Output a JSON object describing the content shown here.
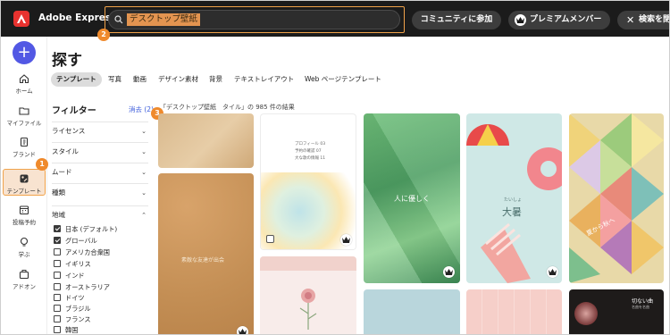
{
  "header": {
    "brand": "Adobe Express",
    "search_value": "デスクトップ壁紙",
    "community_label": "コミュニティに参加",
    "premium_label": "プレミアムメンバー",
    "close_search_label": "検索を閉"
  },
  "badges": {
    "one": "1",
    "two": "2",
    "three": "3"
  },
  "sidebar": {
    "items": [
      {
        "label": "ホーム",
        "icon": "home-icon"
      },
      {
        "label": "マイファイル",
        "icon": "folder-icon"
      },
      {
        "label": "ブランド",
        "icon": "brand-icon"
      },
      {
        "label": "テンプレート",
        "icon": "template-icon",
        "active": true
      },
      {
        "label": "投稿予約",
        "icon": "calendar-icon"
      },
      {
        "label": "学ぶ",
        "icon": "bulb-icon"
      },
      {
        "label": "アドオン",
        "icon": "addon-icon"
      }
    ]
  },
  "main": {
    "title": "探す",
    "tabs": [
      "テンプレート",
      "写真",
      "動画",
      "デザイン素材",
      "背景",
      "テキストレイアウト",
      "Web ページテンプレート"
    ]
  },
  "filters": {
    "title": "フィルター",
    "clear_label": "消去 (2)",
    "results_text": "「デスクトップ壁紙　タイル」の 985 件の結果",
    "sections": [
      {
        "label": "ライセンス",
        "chevron": "⌄"
      },
      {
        "label": "スタイル",
        "chevron": "⌄"
      },
      {
        "label": "ムード",
        "chevron": "⌄"
      },
      {
        "label": "種類",
        "chevron": "⌄"
      },
      {
        "label": "地域",
        "chevron": "⌃"
      }
    ],
    "regions": [
      {
        "label": "日本 (デフォルト)",
        "checked": true
      },
      {
        "label": "グローバル",
        "checked": true
      },
      {
        "label": "アメリカ合衆国",
        "checked": false
      },
      {
        "label": "イギリス",
        "checked": false
      },
      {
        "label": "インド",
        "checked": false
      },
      {
        "label": "オーストラリア",
        "checked": false
      },
      {
        "label": "ドイツ",
        "checked": false
      },
      {
        "label": "ブラジル",
        "checked": false
      },
      {
        "label": "フランス",
        "checked": false
      },
      {
        "label": "韓国",
        "checked": false
      }
    ]
  },
  "cards": {
    "c3_lines": [
      "プロフィール 03",
      "予約の確認 07",
      "大な歌の情報 11"
    ],
    "c4_text": "人に優しく",
    "c5_small": "たいしょ",
    "c5_text": "大暑",
    "c6_text": "夏から秋へ",
    "c7_text": "素敵な友達が出会",
    "c8_text": "切ない曲",
    "c8_sub": "名曲を名曲"
  }
}
